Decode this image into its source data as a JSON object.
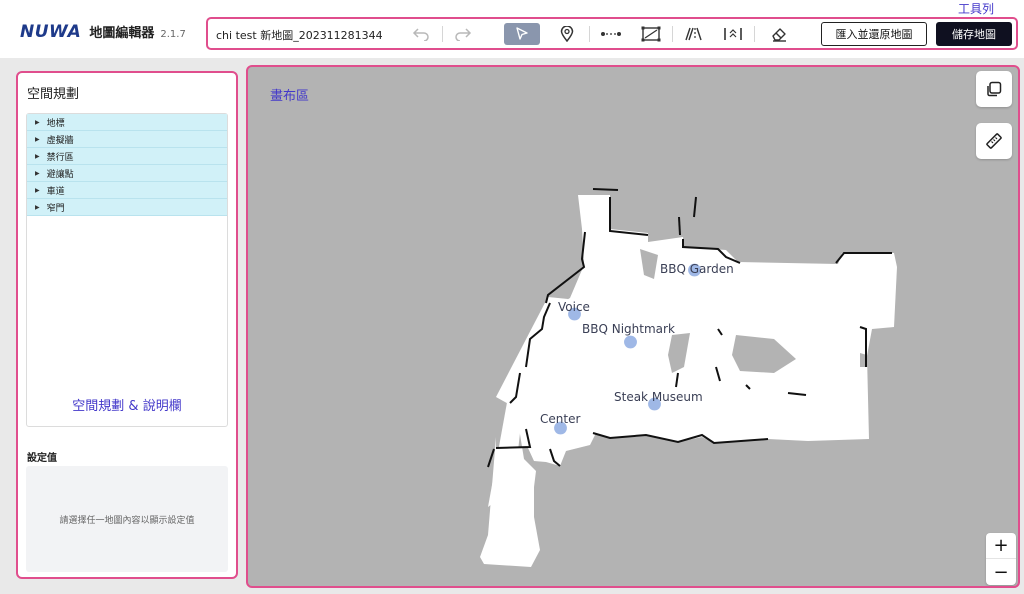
{
  "header": {
    "logo_text": "NUWA",
    "app_title": "地圖編輯器",
    "version": "2.1.7"
  },
  "toolbar": {
    "label": "工具列",
    "map_name": "chi test 新地圖_202311281344",
    "import_label": "匯入並還原地圖",
    "save_label": "儲存地圖"
  },
  "left_panel": {
    "title": "空間規劃",
    "layers": [
      "地標",
      "虛擬牆",
      "禁行區",
      "避讓點",
      "車道",
      "窄門"
    ],
    "caption": "空間規劃 & 說明欄",
    "settings_title": "設定值",
    "settings_placeholder": "請選擇任一地圖內容以顯示設定值"
  },
  "canvas": {
    "label": "畫布區",
    "landmarks": [
      "BBQ Garden",
      "Voice",
      "BBQ Nightmark",
      "Steak Museum",
      "Center"
    ],
    "zoom_in": "+",
    "zoom_out": "−"
  },
  "colors": {
    "accent_pink": "#e04e8d",
    "annotation_indigo": "#4338ca",
    "brand_navy": "#1e3a8a",
    "layer_row_bg": "#d1f1f8",
    "canvas_bg": "#b3b3b3",
    "pin_blue": "#9fb8e6"
  }
}
